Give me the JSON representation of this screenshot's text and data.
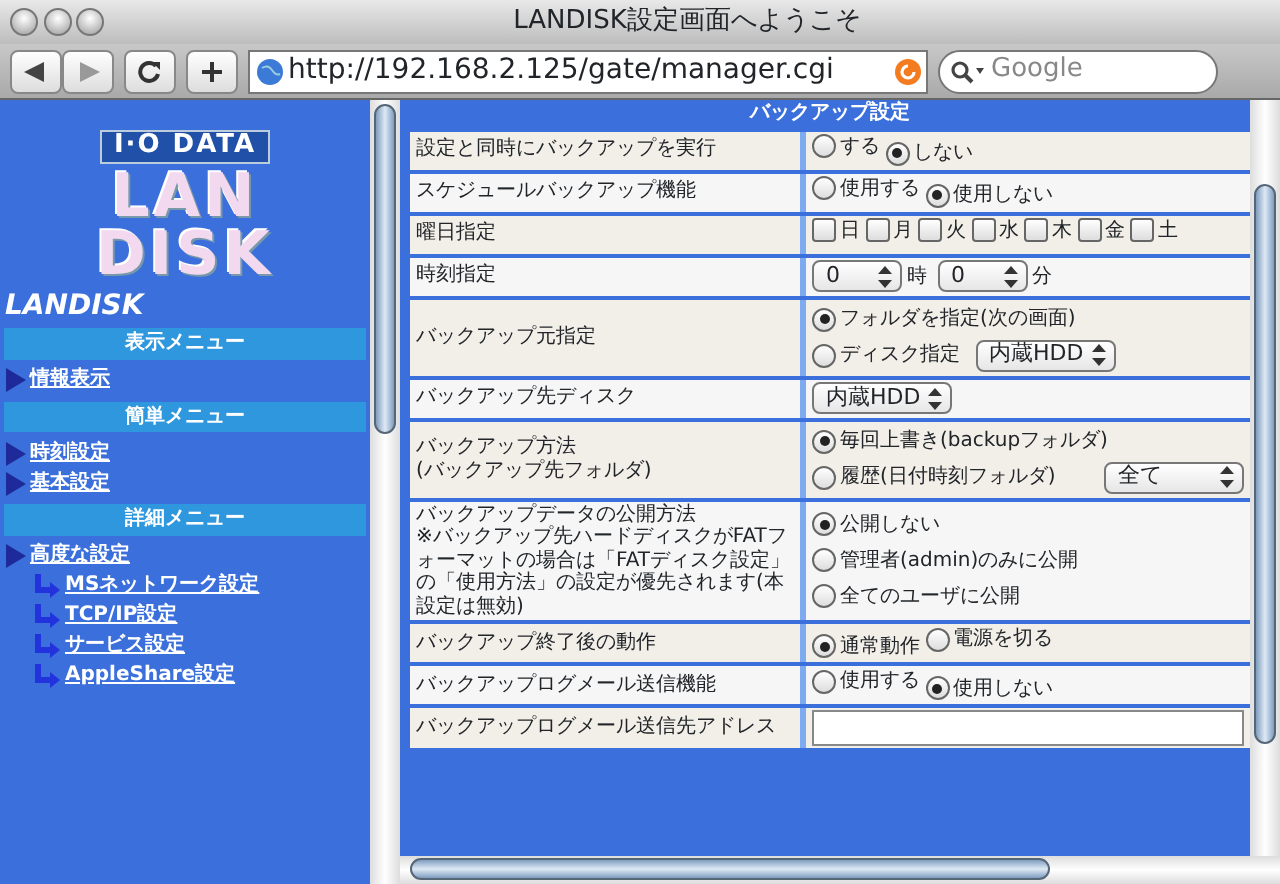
{
  "window": {
    "title": "LANDISK設定画面へようこそ"
  },
  "toolbar": {
    "url": "http://192.168.2.125/gate/manager.cgi",
    "search_placeholder": "Google"
  },
  "sidebar": {
    "logo_maker": "I·O DATA",
    "logo_lines": [
      "LAN",
      "DISK"
    ],
    "brand": "LANDISK",
    "sections": [
      {
        "header": "表示メニュー",
        "items": [
          {
            "label": "情報表示"
          }
        ]
      },
      {
        "header": "簡単メニュー",
        "items": [
          {
            "label": "時刻設定"
          },
          {
            "label": "基本設定"
          }
        ]
      },
      {
        "header": "詳細メニュー",
        "items": [
          {
            "label": "高度な設定",
            "children": [
              {
                "label": "MSネットワーク設定"
              },
              {
                "label": "TCP/IP設定"
              },
              {
                "label": "サービス設定"
              },
              {
                "label": "AppleShare設定"
              }
            ]
          }
        ]
      }
    ]
  },
  "form": {
    "title": "バックアップ設定",
    "rows": [
      {
        "label": [
          "設定と同時にバックアップを実行"
        ],
        "kind": "radio_row",
        "options": [
          {
            "label": "する",
            "selected": false
          },
          {
            "label": "しない",
            "selected": true
          }
        ]
      },
      {
        "label": [
          "スケジュールバックアップ機能"
        ],
        "kind": "radio_row",
        "options": [
          {
            "label": "使用する",
            "selected": false
          },
          {
            "label": "使用しない",
            "selected": true
          }
        ]
      },
      {
        "label": [
          "曜日指定"
        ],
        "kind": "checkboxes",
        "options": [
          {
            "label": "日",
            "checked": false
          },
          {
            "label": "月",
            "checked": false
          },
          {
            "label": "火",
            "checked": false
          },
          {
            "label": "水",
            "checked": false
          },
          {
            "label": "木",
            "checked": false
          },
          {
            "label": "金",
            "checked": false
          },
          {
            "label": "土",
            "checked": false
          }
        ]
      },
      {
        "label": [
          "時刻指定"
        ],
        "kind": "time",
        "selects": [
          {
            "value": "0",
            "unit": "時"
          },
          {
            "value": "0",
            "unit": "分"
          }
        ]
      },
      {
        "label": [
          "バックアップ元指定"
        ],
        "kind": "radio_stack",
        "options": [
          {
            "label": "フォルダを指定(次の画面)",
            "selected": true
          },
          {
            "label": "ディスク指定",
            "selected": false,
            "select": "内蔵HDD"
          }
        ]
      },
      {
        "label": [
          "バックアップ先ディスク"
        ],
        "kind": "select",
        "value": "内蔵HDD"
      },
      {
        "label": [
          "バックアップ方法",
          "(バックアップ先フォルダ)"
        ],
        "kind": "radio_stack",
        "options": [
          {
            "label": "毎回上書き(backupフォルダ)",
            "selected": true
          },
          {
            "label": "履歴(日付時刻フォルダ)",
            "selected": false,
            "select": "全て"
          }
        ]
      },
      {
        "label": [
          "バックアップデータの公開方法",
          "※バックアップ先ハードディスクがFATフォーマットの場合は「FATディスク設定」の「使用方法」の設定が優先されます(本設定は無効)"
        ],
        "kind": "radio_stack",
        "options": [
          {
            "label": "公開しない",
            "selected": true
          },
          {
            "label": "管理者(admin)のみに公開",
            "selected": false
          },
          {
            "label": "全てのユーザに公開",
            "selected": false
          }
        ]
      },
      {
        "label": [
          "バックアップ終了後の動作"
        ],
        "kind": "radio_row",
        "options": [
          {
            "label": "通常動作",
            "selected": true
          },
          {
            "label": "電源を切る",
            "selected": false
          }
        ]
      },
      {
        "label": [
          "バックアップログメール送信機能"
        ],
        "kind": "radio_row",
        "options": [
          {
            "label": "使用する",
            "selected": false
          },
          {
            "label": "使用しない",
            "selected": true
          }
        ]
      },
      {
        "label": [
          "バックアップログメール送信先アドレス"
        ],
        "kind": "text"
      }
    ]
  }
}
